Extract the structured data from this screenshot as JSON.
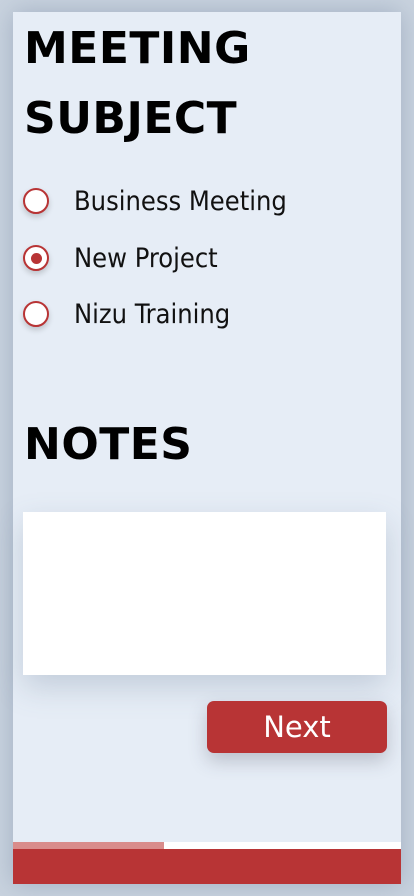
{
  "meeting": {
    "title": "MEETING SUBJECT",
    "options": [
      {
        "label": "Business Meeting",
        "checked": false
      },
      {
        "label": "New Project",
        "checked": true
      },
      {
        "label": "Nizu Training",
        "checked": false
      }
    ]
  },
  "notes": {
    "title": "NOTES",
    "value": ""
  },
  "actions": {
    "next_label": "Next"
  },
  "progress": {
    "fraction": 0.39
  },
  "colors": {
    "accent": "#b83435",
    "accent_light": "#d98c8b",
    "panel_bg": "#e6edf6",
    "page_bg": "#c9d3df"
  }
}
